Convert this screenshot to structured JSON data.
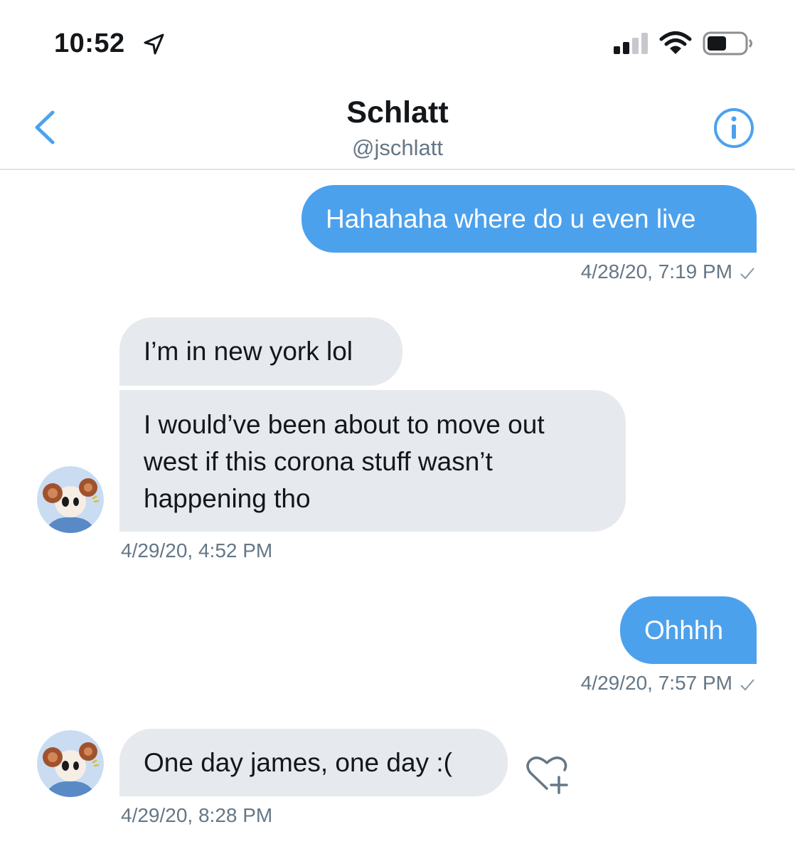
{
  "status_bar": {
    "time": "10:52",
    "icons": [
      "location-arrow-icon",
      "cellular-signal-icon",
      "wifi-icon",
      "battery-icon"
    ]
  },
  "header": {
    "title": "Schlatt",
    "handle": "@jschlatt",
    "back_icon": "chevron-left-icon",
    "info_icon": "info-icon"
  },
  "colors": {
    "accent": "#4ca1ed",
    "received_bubble": "#e6e9ee",
    "secondary_text": "#657786"
  },
  "messages": [
    {
      "direction": "sent",
      "text": "Hahahaha where do u even live",
      "timestamp": "4/28/20, 7:19 PM",
      "seen": true
    },
    {
      "direction": "received",
      "text": "I’m in new york lol"
    },
    {
      "direction": "received",
      "lines": [
        "I would’ve been about to move out",
        "west if this corona stuff wasn’t",
        "happening tho"
      ],
      "timestamp": "4/29/20, 4:52 PM"
    },
    {
      "direction": "sent",
      "text": "Ohhhh",
      "timestamp": "4/29/20, 7:57 PM",
      "seen": true
    },
    {
      "direction": "received",
      "text": "One day james, one day :(",
      "timestamp": "4/29/20, 8:28 PM",
      "reaction_icon": "heart-add-icon"
    }
  ]
}
